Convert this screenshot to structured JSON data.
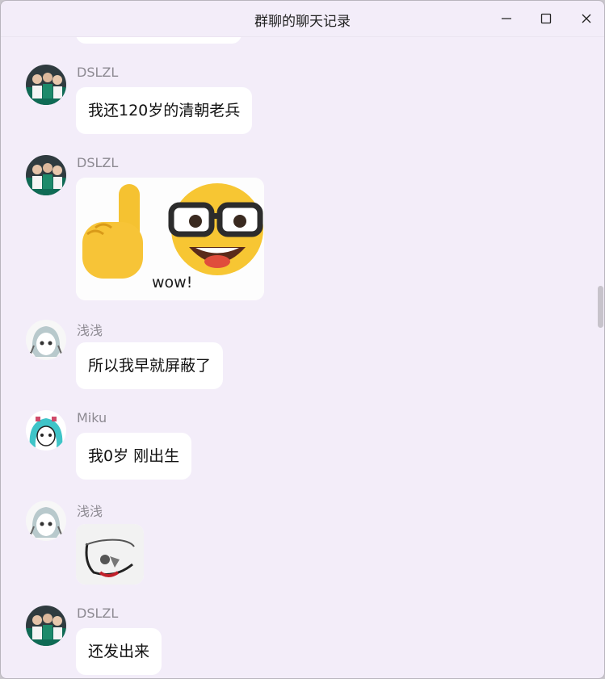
{
  "window": {
    "title": "群聊的聊天记录"
  },
  "messages": [
    {
      "sender": "DSLZL",
      "text": "我还120岁的清朝老兵"
    },
    {
      "sender": "DSLZL",
      "sticker_caption": "wow!"
    },
    {
      "sender": "浅浅",
      "text": "所以我早就屏蔽了"
    },
    {
      "sender": "Miku",
      "text": "我0岁 刚出生"
    },
    {
      "sender": "浅浅"
    },
    {
      "sender": "DSLZL",
      "text": "还发出来"
    }
  ]
}
